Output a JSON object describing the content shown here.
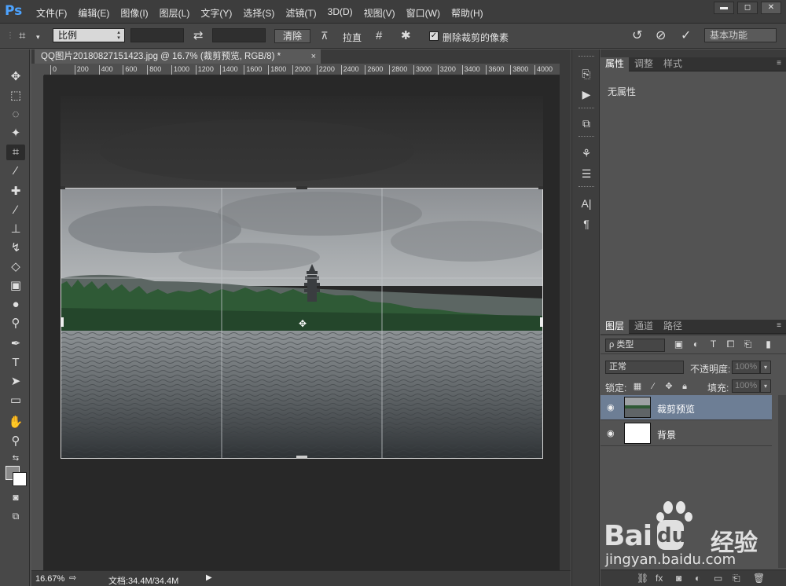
{
  "app": {
    "logo": "Ps"
  },
  "menu": [
    "文件(F)",
    "编辑(E)",
    "图像(I)",
    "图层(L)",
    "文字(Y)",
    "选择(S)",
    "滤镜(T)",
    "3D(D)",
    "视图(V)",
    "窗口(W)",
    "帮助(H)"
  ],
  "window_buttons": {
    "minimize": "▬",
    "maximize": "◻",
    "close": "✕"
  },
  "options_bar": {
    "ratio_select": "比例",
    "clear_button": "清除",
    "straighten_label": "拉直",
    "delete_cropped_checked": true,
    "delete_cropped_label": "删除裁剪的像素",
    "workspace": "基本功能"
  },
  "document": {
    "tab_title": "QQ图片20180827151423.jpg @ 16.7% (裁剪预览, RGB/8) *",
    "tab_close": "×",
    "ruler_ticks": [
      "0",
      "200",
      "400",
      "600",
      "800",
      "1000",
      "1200",
      "1400",
      "1600",
      "1800",
      "2000",
      "2200",
      "2400",
      "2600",
      "2800",
      "3000",
      "3200",
      "3400",
      "3600",
      "3800",
      "4000"
    ]
  },
  "status": {
    "zoom": "16.67%",
    "doc_size": "文档:34.4M/34.4M",
    "arrow": "▶"
  },
  "properties_panel": {
    "tabs": [
      "属性",
      "调整",
      "样式"
    ],
    "empty_text": "无属性"
  },
  "layers_panel": {
    "tabs": [
      "图层",
      "通道",
      "路径"
    ],
    "kind_filter": "ρ 类型",
    "blend_mode": "正常",
    "opacity_label": "不透明度:",
    "opacity_value": "100%",
    "lock_label": "锁定:",
    "fill_label": "填充:",
    "fill_value": "100%",
    "layers": [
      {
        "name": "裁剪预览",
        "selected": true,
        "visible": true
      },
      {
        "name": "背景",
        "selected": false,
        "visible": true
      }
    ]
  },
  "watermark": {
    "brand": "Bai",
    "brand2": "经验",
    "url": "jingyan.baidu.com"
  },
  "colors": {
    "ui_dark": "#535353",
    "selection": "#6d7e95",
    "ps_blue": "#4da3ff"
  }
}
